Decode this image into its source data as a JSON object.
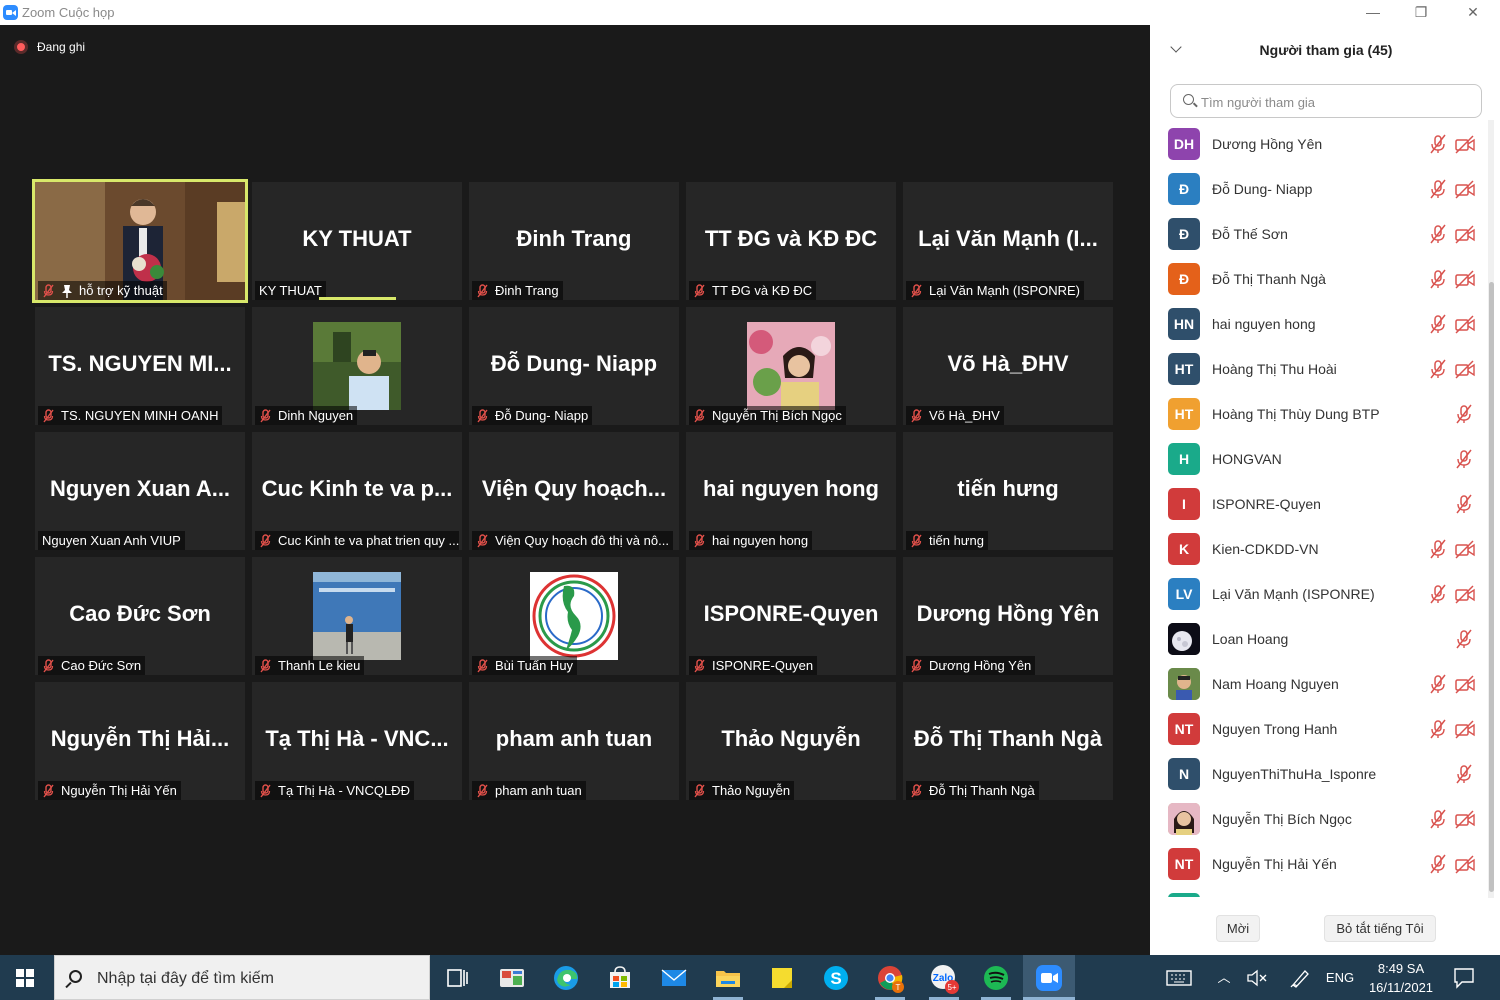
{
  "window": {
    "title": "Zoom Cuộc họp",
    "minimize_glyph": "—",
    "restore_glyph": "❐",
    "close_glyph": "✕",
    "icon": "zoom-logo-icon"
  },
  "recording": {
    "label": "Đang ghi",
    "icon": "record-icon"
  },
  "grid": {
    "tiles": [
      {
        "big": "",
        "label": "hỗ trợ kỹ thuật",
        "mic_muted": true,
        "pinned": true,
        "video": "speaker-video",
        "active": true
      },
      {
        "big": "KY THUAT",
        "label": "KY THUAT",
        "mic_muted": false,
        "speaking": true
      },
      {
        "big": "Đinh Trang",
        "label": "Đinh Trang",
        "mic_muted": true
      },
      {
        "big": "TT ĐG và KĐ ĐC",
        "label": "TT ĐG và KĐ ĐC",
        "mic_muted": true
      },
      {
        "big": "Lại Văn Mạnh (I...",
        "label": "Lại Văn Mạnh (ISPONRE)",
        "mic_muted": true
      },
      {
        "big": "TS. NGUYEN MI...",
        "label": "TS. NGUYEN MINH OANH",
        "mic_muted": true
      },
      {
        "big": "",
        "label": "Dinh Nguyen",
        "mic_muted": true,
        "photo": "man-photo"
      },
      {
        "big": "Đỗ Dung- Niapp",
        "label": "Đỗ Dung- Niapp",
        "mic_muted": true
      },
      {
        "big": "",
        "label": "Nguyễn Thị Bích Ngọc",
        "mic_muted": true,
        "photo": "woman-flowers-photo"
      },
      {
        "big": "Võ Hà_ĐHV",
        "label": "Võ Hà_ĐHV",
        "mic_muted": true
      },
      {
        "big": "Nguyen Xuan A...",
        "label": "Nguyen Xuan Anh VIUP",
        "mic_muted": false
      },
      {
        "big": "Cuc Kinh te va p...",
        "label": "Cuc Kinh te va phat trien quy ...",
        "mic_muted": true
      },
      {
        "big": "Viện Quy hoạch...",
        "label": "Viện Quy hoạch đô thị và nô...",
        "mic_muted": true
      },
      {
        "big": "hai nguyen hong",
        "label": "hai nguyen hong",
        "mic_muted": true
      },
      {
        "big": "tiến hưng",
        "label": "tiến hưng",
        "mic_muted": true
      },
      {
        "big": "Cao Đức Sơn",
        "label": "Cao Đức Sơn",
        "mic_muted": true
      },
      {
        "big": "",
        "label": "Thanh Le kieu",
        "mic_muted": true,
        "photo": "building-photo"
      },
      {
        "big": "",
        "label": "Bùi Tuấn Huy",
        "mic_muted": true,
        "photo": "vietnam-map-logo"
      },
      {
        "big": "ISPONRE-Quyen",
        "label": "ISPONRE-Quyen",
        "mic_muted": true
      },
      {
        "big": "Dương Hồng Yên",
        "label": "Dương Hồng Yên",
        "mic_muted": true
      },
      {
        "big": "Nguyễn Thị Hải...",
        "label": "Nguyễn Thị Hải Yến",
        "mic_muted": true
      },
      {
        "big": "Tạ Thị Hà - VNC...",
        "label": "Tạ Thị Hà - VNCQLĐĐ",
        "mic_muted": true
      },
      {
        "big": "pham anh tuan",
        "label": "pham anh tuan",
        "mic_muted": true
      },
      {
        "big": "Thảo Nguyễn",
        "label": "Thảo Nguyễn",
        "mic_muted": true
      },
      {
        "big": "Đỗ Thị Thanh Ngà",
        "label": "Đỗ Thị Thanh Ngà",
        "mic_muted": true
      }
    ]
  },
  "panel": {
    "title": "Người tham gia (45)",
    "search_placeholder": "Tìm người tham gia",
    "participants": [
      {
        "initials": "DH",
        "name": "Dương Hồng Yên",
        "color": "#8e44ad",
        "cam_off": true
      },
      {
        "initials": "Đ",
        "name": "Đỗ Dung- Niapp",
        "color": "#2b7fc1",
        "cam_off": true
      },
      {
        "initials": "Đ",
        "name": "Đỗ Thế Sơn",
        "color": "#2f4f6b",
        "cam_off": true
      },
      {
        "initials": "Đ",
        "name": "Đỗ Thị Thanh Ngà",
        "color": "#e4611a",
        "cam_off": true
      },
      {
        "initials": "HN",
        "name": "hai nguyen hong",
        "color": "#2f4f6b",
        "cam_off": true
      },
      {
        "initials": "HT",
        "name": "Hoàng Thị Thu Hoài",
        "color": "#2f4f6b",
        "cam_off": true
      },
      {
        "initials": "HT",
        "name": "Hoàng Thị Thùy Dung BTP",
        "color": "#f0a030",
        "cam_off": false
      },
      {
        "initials": "H",
        "name": "HONGVAN",
        "color": "#1aaa8a",
        "cam_off": false
      },
      {
        "initials": "I",
        "name": "ISPONRE-Quyen",
        "color": "#d13b3b",
        "cam_off": false
      },
      {
        "initials": "K",
        "name": "Kien-CDKDD-VN",
        "color": "#d13b3b",
        "cam_off": true
      },
      {
        "initials": "LV",
        "name": "Lại Văn Mạnh (ISPONRE)",
        "color": "#2b7fc1",
        "cam_off": true
      },
      {
        "initials": "",
        "name": "Loan Hoang",
        "color": "#111111",
        "cam_off": false,
        "photo": "moon-photo"
      },
      {
        "initials": "",
        "name": "Nam Hoang Nguyen",
        "color": "#6a8a4a",
        "cam_off": true,
        "photo": "man-photo"
      },
      {
        "initials": "NT",
        "name": "Nguyen Trong Hanh",
        "color": "#d13b3b",
        "cam_off": true
      },
      {
        "initials": "N",
        "name": "NguyenThiThuHa_Isponre",
        "color": "#2f4f6b",
        "cam_off": false
      },
      {
        "initials": "",
        "name": "Nguyễn Thị Bích Ngọc",
        "color": "#c9a07a",
        "cam_off": true,
        "photo": "woman-photo"
      },
      {
        "initials": "NT",
        "name": "Nguyễn Thị Hải Yến",
        "color": "#d13b3b",
        "cam_off": true
      }
    ],
    "invite_label": "Mời",
    "mute_me_label": "Bỏ tắt tiếng Tôi"
  },
  "taskbar": {
    "search_placeholder": "Nhập tại đây để tìm kiếm",
    "lang": "ENG",
    "time": "8:49 SA",
    "date": "16/11/2021",
    "badge_chat": "5+",
    "badge_chrome": "T"
  }
}
